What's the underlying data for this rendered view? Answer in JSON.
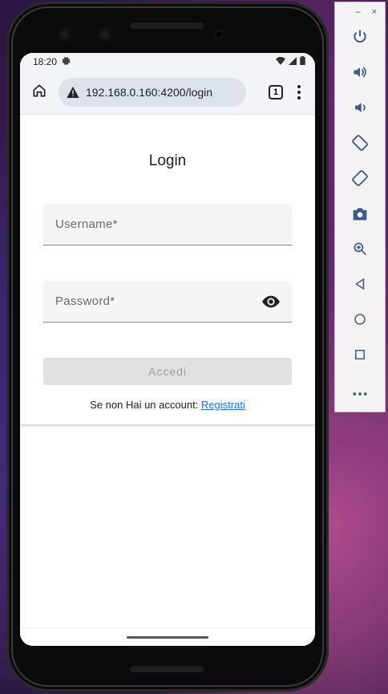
{
  "status": {
    "time": "18:20"
  },
  "browser": {
    "url": "192.168.0.160:4200/login",
    "tab_count": "1"
  },
  "login": {
    "title": "Login",
    "username_placeholder": "Username*",
    "password_placeholder": "Password*",
    "submit_label": "Accedi",
    "signup_text": "Se non Hai un account:",
    "signup_link": "Registrati"
  },
  "emulator": {
    "minimize": "–",
    "close": "×",
    "tools": [
      "power-icon",
      "volume-up-icon",
      "volume-down-icon",
      "rotate-left-icon",
      "rotate-right-icon",
      "camera-icon",
      "zoom-icon",
      "back-icon",
      "home-icon",
      "overview-icon",
      "more-icon"
    ]
  },
  "colors": {
    "link": "#1a73e8",
    "field_bg": "#f5f5f5",
    "button_disabled": "#e0e0e0"
  }
}
